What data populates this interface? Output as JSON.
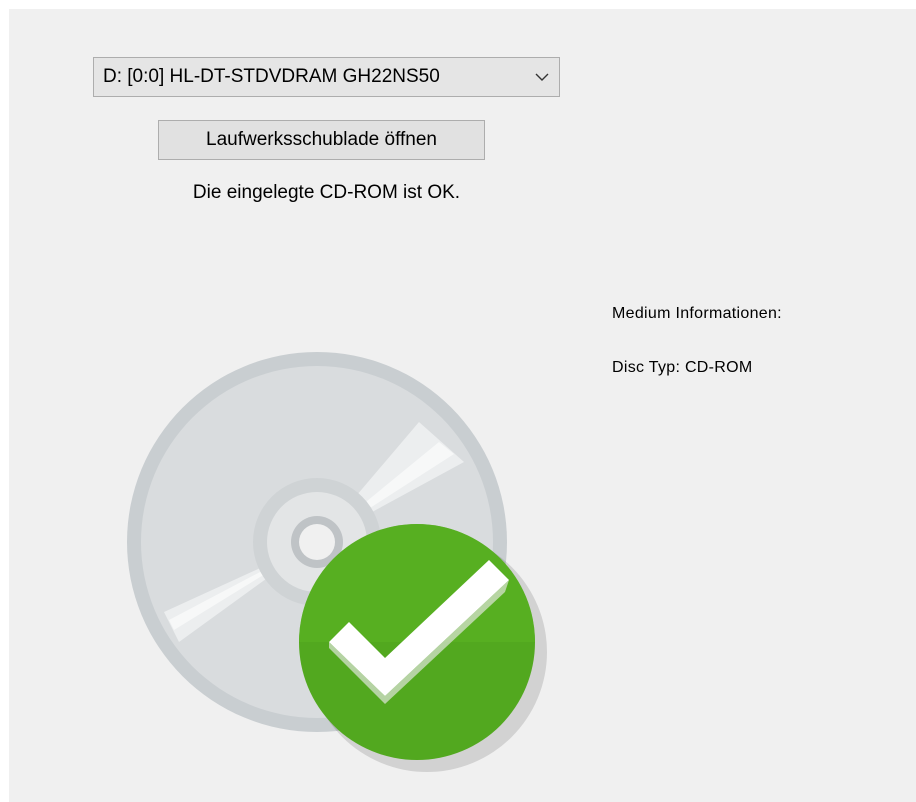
{
  "drive_selector": {
    "selected": "D: [0:0] HL-DT-STDVDRAM GH22NS50",
    "icon": "chevron-down-icon"
  },
  "open_tray_button": {
    "label": "Laufwerksschublade öffnen"
  },
  "status": {
    "message": "Die eingelegte CD-ROM ist OK."
  },
  "medium_info": {
    "heading": "Medium Informationen:",
    "disc_type": "Disc Typ: CD-ROM"
  },
  "graphic": {
    "icon": "cd-disc-ok-icon",
    "disc_color": "#d4d8da",
    "check_badge_color": "#52a81f",
    "check_mark_color": "#ffffff"
  }
}
